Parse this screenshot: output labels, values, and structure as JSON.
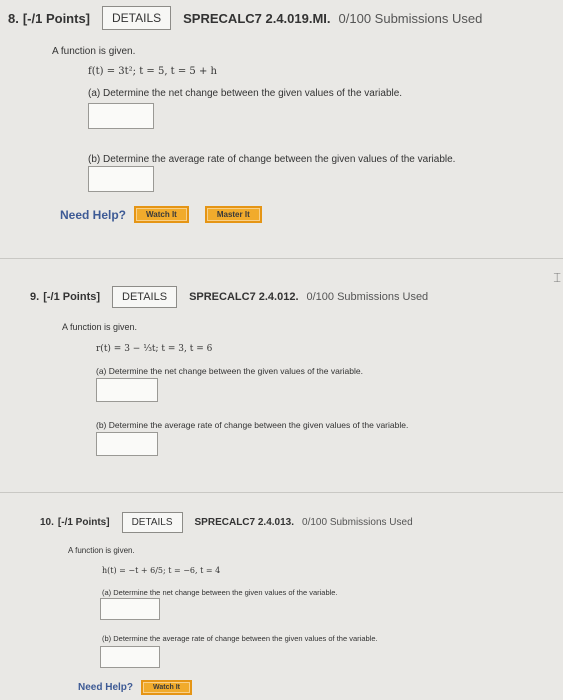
{
  "problems": [
    {
      "number": "8.",
      "points": "[-/1 Points]",
      "details_label": "DETAILS",
      "code": "SPRECALC7 2.4.019.MI.",
      "submissions": "0/100 Submissions Used",
      "intro": "A function is given.",
      "formula": "f(t) = 3t²;    t = 5, t = 5 + h",
      "part_a": "(a) Determine the net change between the given values of the variable.",
      "part_b": "(b) Determine the average rate of change between the given values of the variable.",
      "need_help": "Need Help?",
      "help_buttons": [
        "Watch It",
        "Master It"
      ]
    },
    {
      "number": "9.",
      "points": "[-/1 Points]",
      "details_label": "DETAILS",
      "code": "SPRECALC7 2.4.012.",
      "submissions": "0/100 Submissions Used",
      "intro": "A function is given.",
      "formula": "r(t) = 3 − ⅓t;    t = 3, t = 6",
      "part_a": "(a) Determine the net change between the given values of the variable.",
      "part_b": "(b) Determine the average rate of change between the given values of the variable."
    },
    {
      "number": "10.",
      "points": "[-/1 Points]",
      "details_label": "DETAILS",
      "code": "SPRECALC7 2.4.013.",
      "submissions": "0/100 Submissions Used",
      "intro": "A function is given.",
      "formula": "h(t) = −t + 6/5;    t = −6, t = 4",
      "part_a": "(a) Determine the net change between the given values of the variable.",
      "part_b": "(b) Determine the average rate of change between the given values of the variable.",
      "need_help": "Need Help?",
      "help_buttons": [
        "Watch It"
      ]
    }
  ]
}
